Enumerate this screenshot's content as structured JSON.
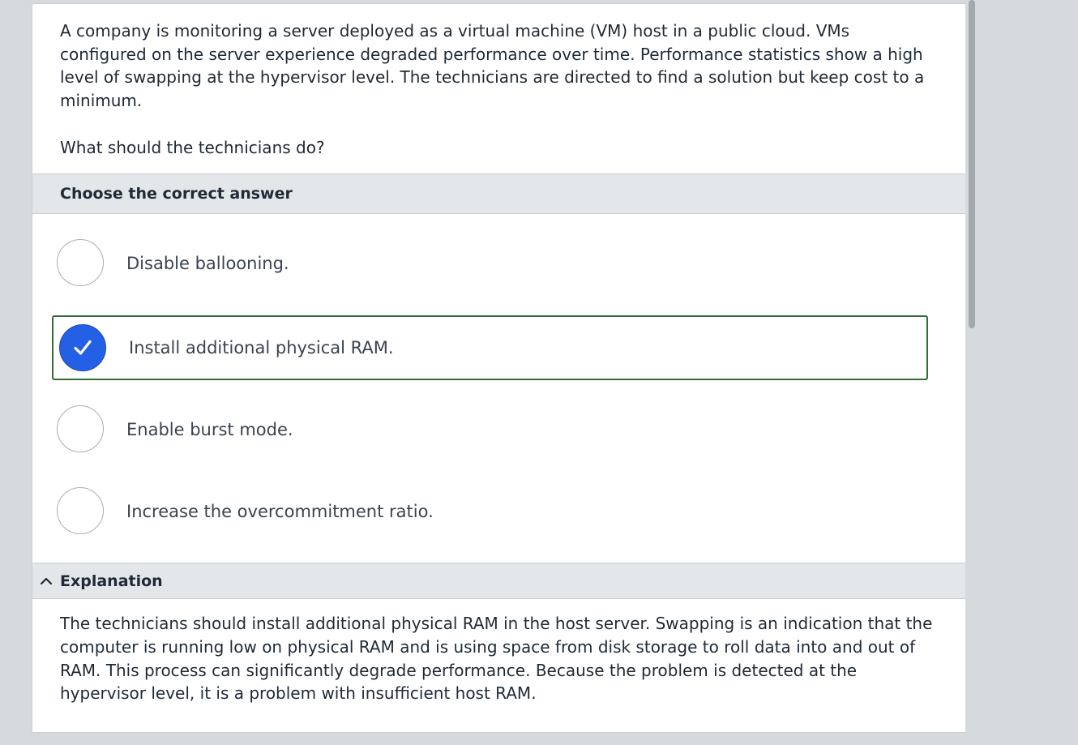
{
  "question": {
    "stem": "A company is monitoring a server deployed as a virtual machine (VM) host in a public cloud. VMs configured on the server experience degraded performance over time. Performance statistics show a high level of swapping at the hypervisor level. The technicians are directed to find a solution but keep cost to a minimum.",
    "prompt": "What should the technicians do?"
  },
  "answers": {
    "heading": "Choose the correct answer",
    "options": [
      {
        "label": "Disable ballooning.",
        "selected": false
      },
      {
        "label": "Install additional physical RAM.",
        "selected": true
      },
      {
        "label": "Enable burst mode.",
        "selected": false
      },
      {
        "label": "Increase the overcommitment ratio.",
        "selected": false
      }
    ]
  },
  "explanation": {
    "heading": "Explanation",
    "icon": "chevron-up-icon",
    "text": "The technicians should install additional physical RAM in the host server. Swapping is an indication that the computer is running low on physical RAM and is using space from disk storage to roll data into and out of RAM. This process can significantly degrade performance. Because the problem is detected at the hypervisor level, it is a problem with insufficient host RAM."
  },
  "colors": {
    "selected_radio": "#2460e6",
    "selected_border": "#2f6d32",
    "section_bar": "#e4e7ea"
  }
}
